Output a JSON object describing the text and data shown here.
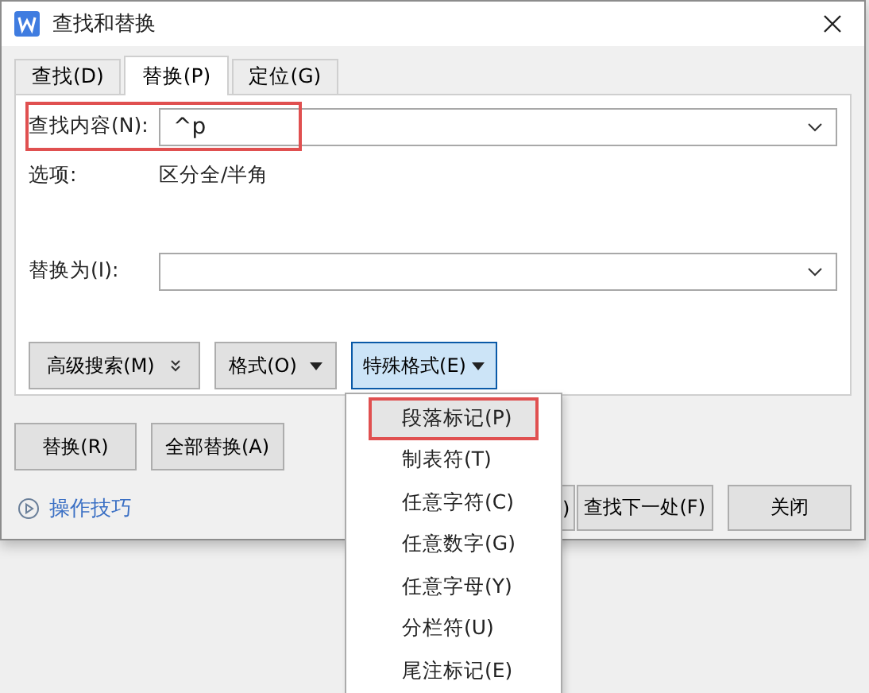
{
  "window": {
    "title": "查找和替换"
  },
  "tabs": [
    {
      "label": "查找(D)",
      "selected": false
    },
    {
      "label": "替换(P)",
      "selected": true
    },
    {
      "label": "定位(G)",
      "selected": false
    }
  ],
  "find": {
    "label": "查找内容(N):",
    "value": "^p",
    "highlighted": true
  },
  "options": {
    "label": "选项:",
    "value": "区分全/半角"
  },
  "replace": {
    "label": "替换为(I):"
  },
  "panel_buttons": [
    {
      "label": "高级搜索(M)",
      "kind": "expand",
      "active": false
    },
    {
      "label": "格式(O)",
      "kind": "dropdown",
      "active": false
    },
    {
      "label": "特殊格式(E)",
      "kind": "dropdown",
      "active": true
    }
  ],
  "action_buttons": [
    {
      "label": "替换(R)"
    },
    {
      "label": "全部替换(A)"
    }
  ],
  "help_link": "操作技巧",
  "footer_buttons": [
    {
      "label": ")",
      "kind": "partial"
    },
    {
      "label": "查找下一处(F)",
      "kind": "full"
    },
    {
      "label": "关闭",
      "kind": "full"
    }
  ],
  "menu": [
    {
      "label": "段落标记(P)",
      "selected": true
    },
    {
      "label": "制表符(T)",
      "selected": false
    },
    {
      "label": "任意字符(C)",
      "selected": false
    },
    {
      "label": "任意数字(G)",
      "selected": false
    },
    {
      "label": "任意字母(Y)",
      "selected": false
    },
    {
      "label": "分栏符(U)",
      "selected": false
    },
    {
      "label": "尾注标记(E)",
      "selected": false
    }
  ]
}
